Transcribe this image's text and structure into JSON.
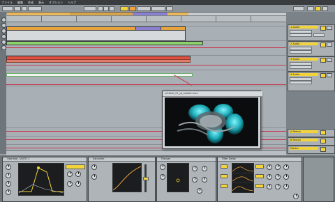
{
  "menu": [
    "ファイル",
    "編集",
    "作成",
    "表示",
    "オプション",
    "ヘルプ"
  ],
  "tracks": [
    {
      "name": "1 Audio"
    },
    {
      "name": "2 Audio"
    },
    {
      "name": "3 Audio"
    },
    {
      "name": "4 Audio"
    }
  ],
  "returns": [
    "A Return",
    "B Return"
  ],
  "master": "Master",
  "video_window": {
    "title": "untitled_01_pf_bubble.mov"
  },
  "devices": [
    {
      "name": "Operator / AUTO 1"
    },
    {
      "name": "Saturator"
    },
    {
      "name": "Flanger"
    },
    {
      "name": "Filter Delay"
    }
  ],
  "colors": {
    "accent_yellow": "#f2d33a",
    "clip_orange": "#e9a33a",
    "clip_green": "#8ed16a",
    "clip_red": "#e0503e",
    "automation": "#c7354c"
  }
}
